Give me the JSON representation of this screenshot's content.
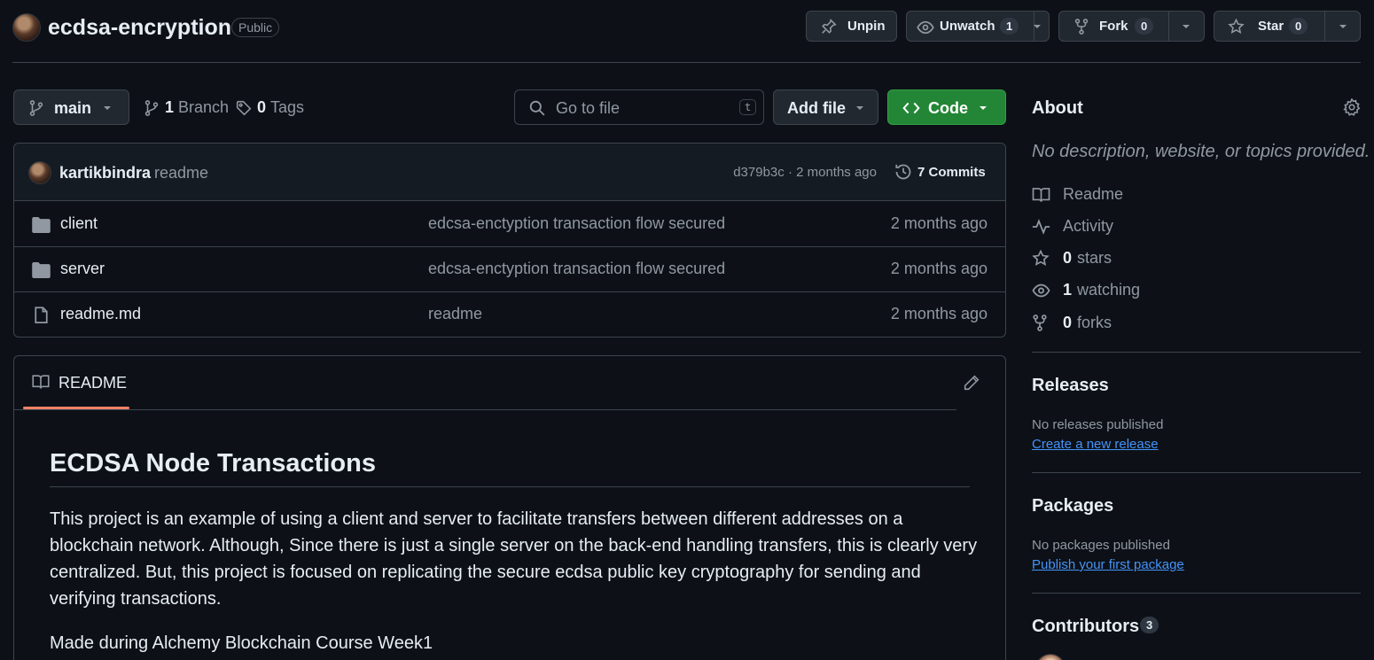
{
  "repo": {
    "name": "ecdsa-encryption",
    "visibility": "Public"
  },
  "actions": {
    "unpin_label": "Unpin",
    "unwatch_label": "Unwatch",
    "watch_count": "1",
    "fork_label": "Fork",
    "fork_count": "0",
    "star_label": "Star",
    "star_count": "0"
  },
  "toolbar": {
    "branch": "main",
    "branch_count": "1",
    "branch_label": "Branch",
    "tag_count": "0",
    "tag_label": "Tags",
    "search_placeholder": "Go to file",
    "search_shortcut": "t",
    "add_file_label": "Add file",
    "code_label": "Code"
  },
  "latest_commit": {
    "author": "kartikbindra",
    "message": "readme",
    "sha_time": "d379b3c · 2 months ago",
    "commits_count": "7",
    "commits_label": "Commits"
  },
  "files": [
    {
      "name": "client",
      "type": "folder",
      "message": "edcsa-enctyption transaction flow secured",
      "date": "2 months ago"
    },
    {
      "name": "server",
      "type": "folder",
      "message": "edcsa-enctyption transaction flow secured",
      "date": "2 months ago"
    },
    {
      "name": "readme.md",
      "type": "file",
      "message": "readme",
      "date": "2 months ago"
    }
  ],
  "readme": {
    "tab_label": "README",
    "title": "ECDSA Node Transactions",
    "lines": [
      "This project is an example of using a client and server to facilitate transfers between different addresses on a",
      "blockchain network. Although, Since there is just a single server on the back-end handling transfers, this is clearly very",
      "centralized. But, this project is focused on replicating the secure ecdsa public key cryptography for sending and",
      "verifying transactions."
    ],
    "para2": "Made during Alchemy Blockchain Course Week1"
  },
  "about": {
    "title": "About",
    "description": "No description, website, or topics provided.",
    "readme_label": "Readme",
    "activity_label": "Activity",
    "stars_count": "0",
    "stars_label": "stars",
    "watching_count": "1",
    "watching_label": "watching",
    "forks_count": "0",
    "forks_label": "forks"
  },
  "releases": {
    "title": "Releases",
    "empty": "No releases published",
    "link": "Create a new release"
  },
  "packages": {
    "title": "Packages",
    "empty": "No packages published",
    "link": "Publish your first package"
  },
  "contributors": {
    "title": "Contributors",
    "count": "3"
  },
  "colors": {
    "accent_green": "#238636",
    "underline_orange": "#f78166",
    "link_blue": "#4493f8",
    "bg": "#0d1117"
  }
}
